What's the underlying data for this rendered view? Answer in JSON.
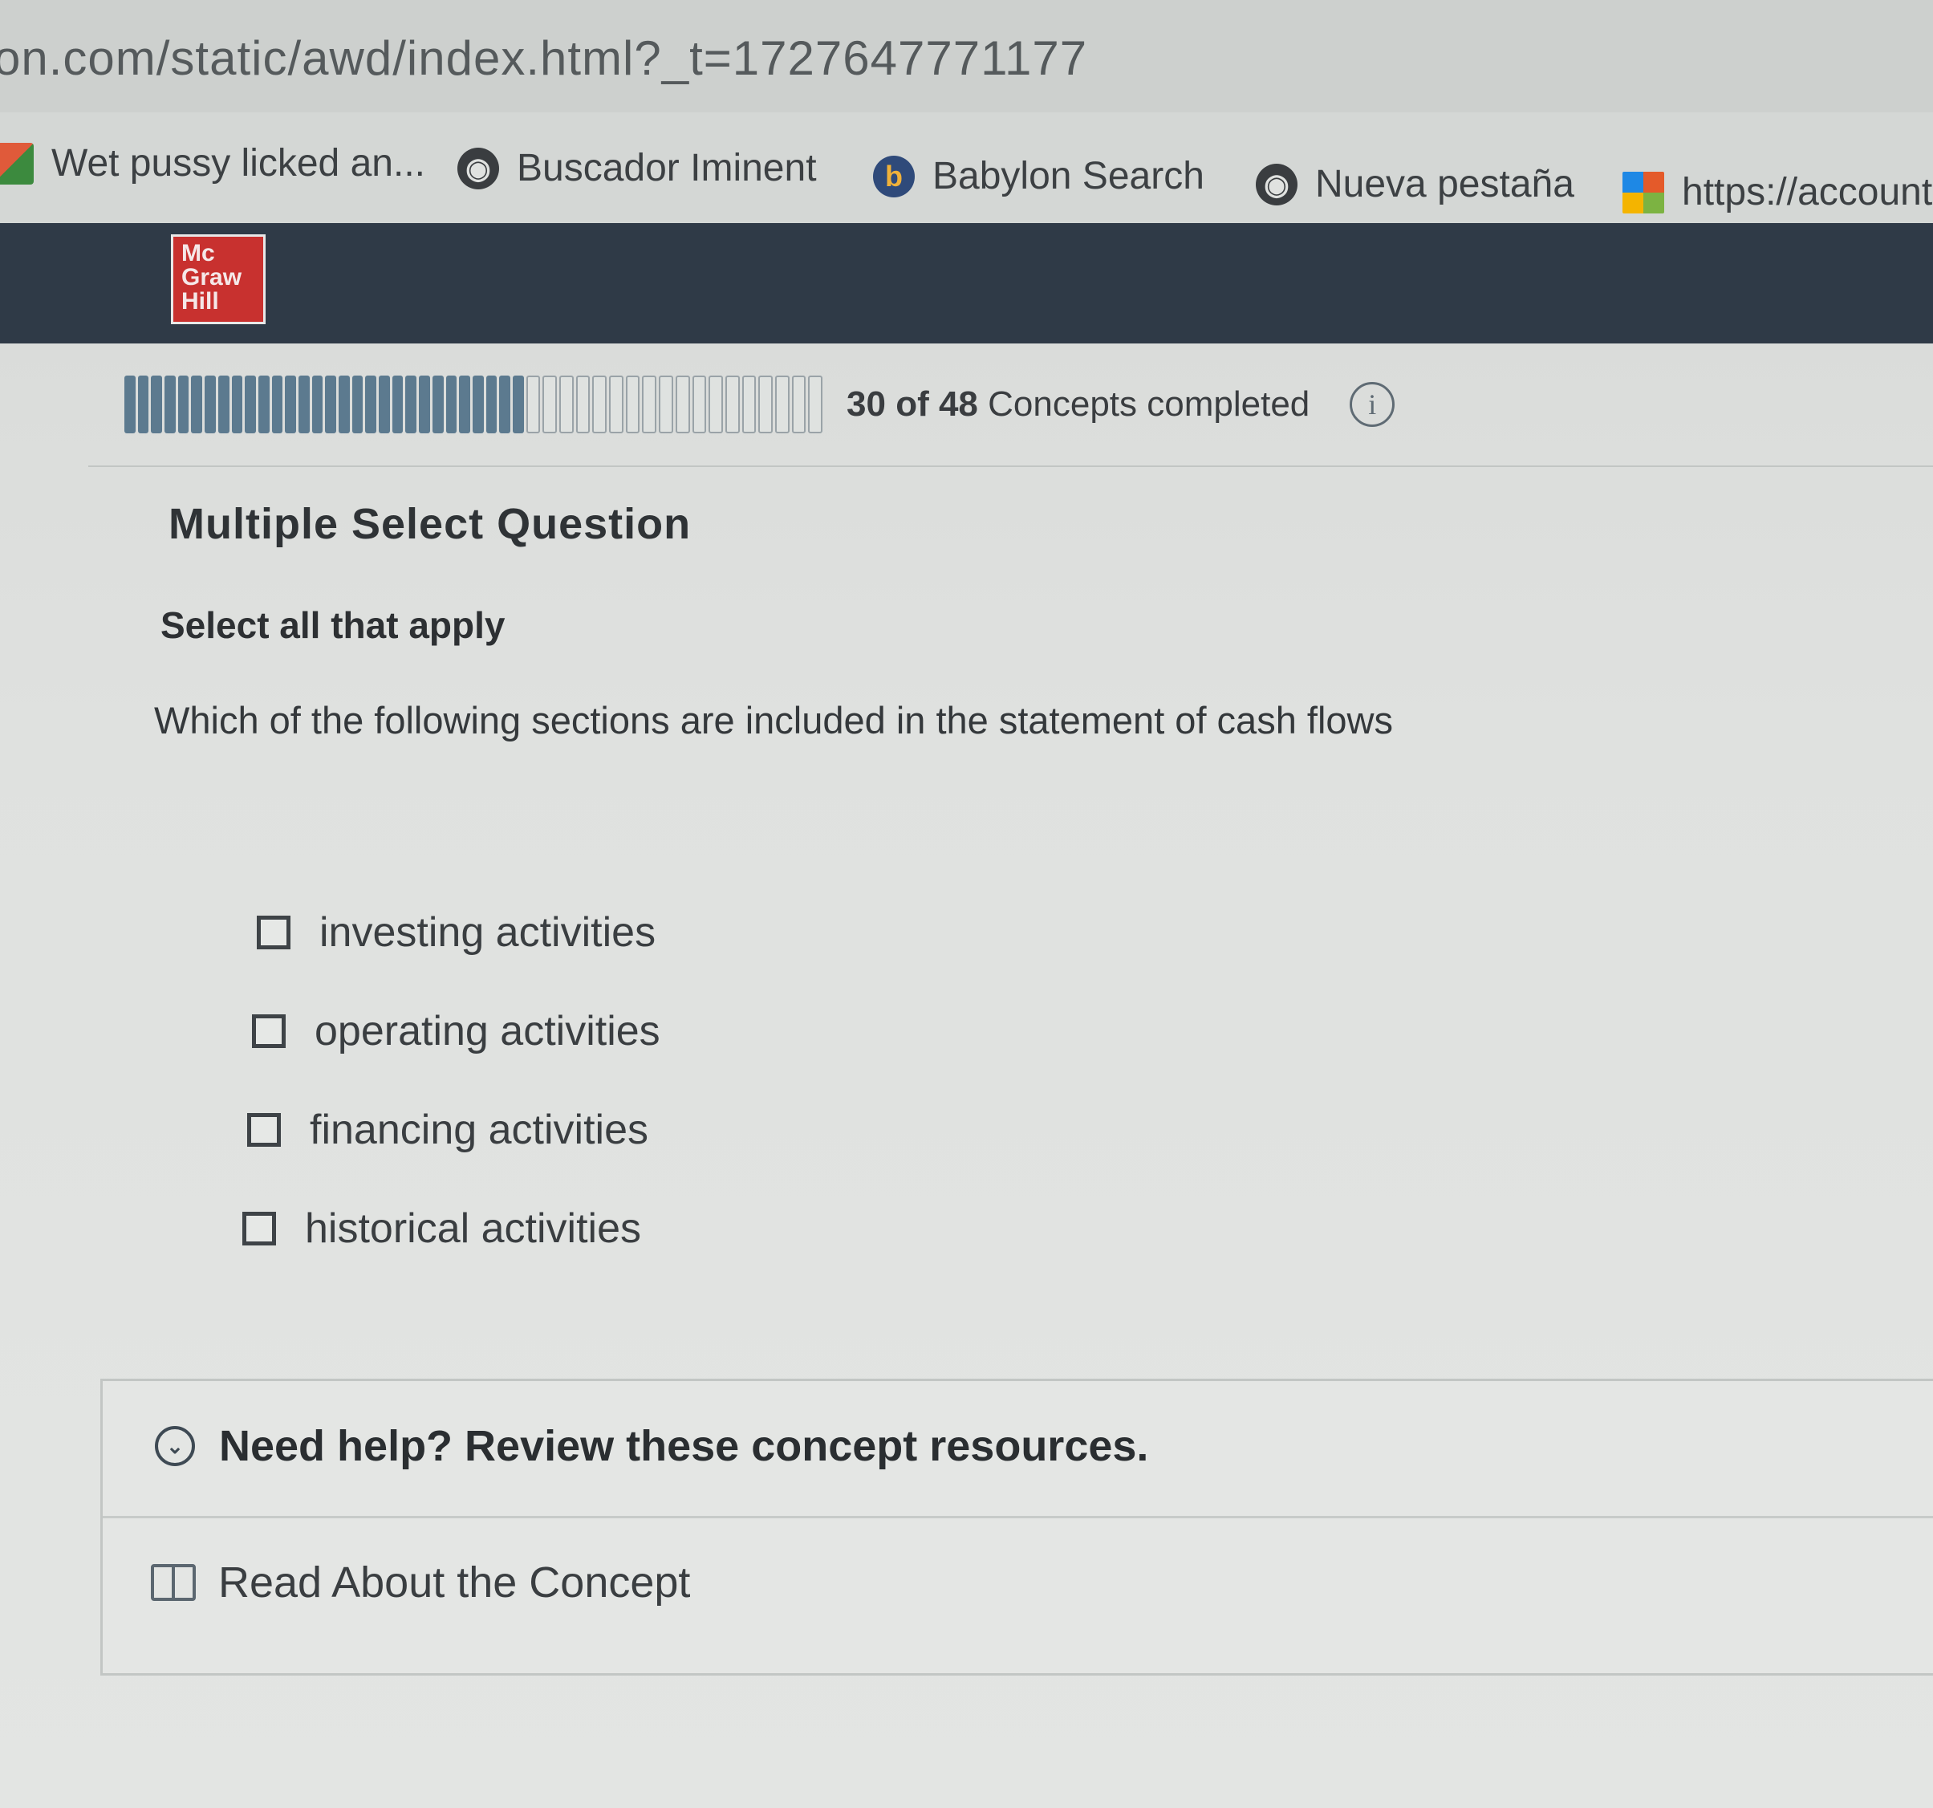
{
  "browser": {
    "url": "on.com/static/awd/index.html?_t=1727647771177",
    "bookmarks": [
      {
        "label": "Wet pussy licked an...",
        "icon": "bookmark-icon"
      },
      {
        "label": "Buscador Iminent",
        "icon": "globe-icon"
      },
      {
        "label": "Babylon Search",
        "icon": "babylon-icon"
      },
      {
        "label": "Nueva pestaña",
        "icon": "globe-icon"
      },
      {
        "label": "https://account",
        "icon": "ms-icon"
      }
    ]
  },
  "header": {
    "logo": {
      "line1": "Mc",
      "line2": "Graw",
      "line3": "Hill"
    },
    "brand_color": "#c8312f",
    "bar_color": "#2f3a47"
  },
  "progress": {
    "completed": "30",
    "of_word": "of",
    "total": "48",
    "suffix": "Concepts completed",
    "fraction": 0.625,
    "info_glyph": "i"
  },
  "question": {
    "type": "Multiple Select Question",
    "instruction": "Select all that apply",
    "prompt": "Which of the following sections are included in the statement of cash flows",
    "options": [
      {
        "label": "investing activities",
        "checked": false
      },
      {
        "label": "operating activities",
        "checked": false
      },
      {
        "label": "financing activities",
        "checked": false
      },
      {
        "label": "historical activities",
        "checked": false
      }
    ]
  },
  "help": {
    "title": "Need help? Review these concept resources.",
    "resources": [
      {
        "label": "Read About the Concept",
        "icon": "book-icon"
      }
    ]
  }
}
